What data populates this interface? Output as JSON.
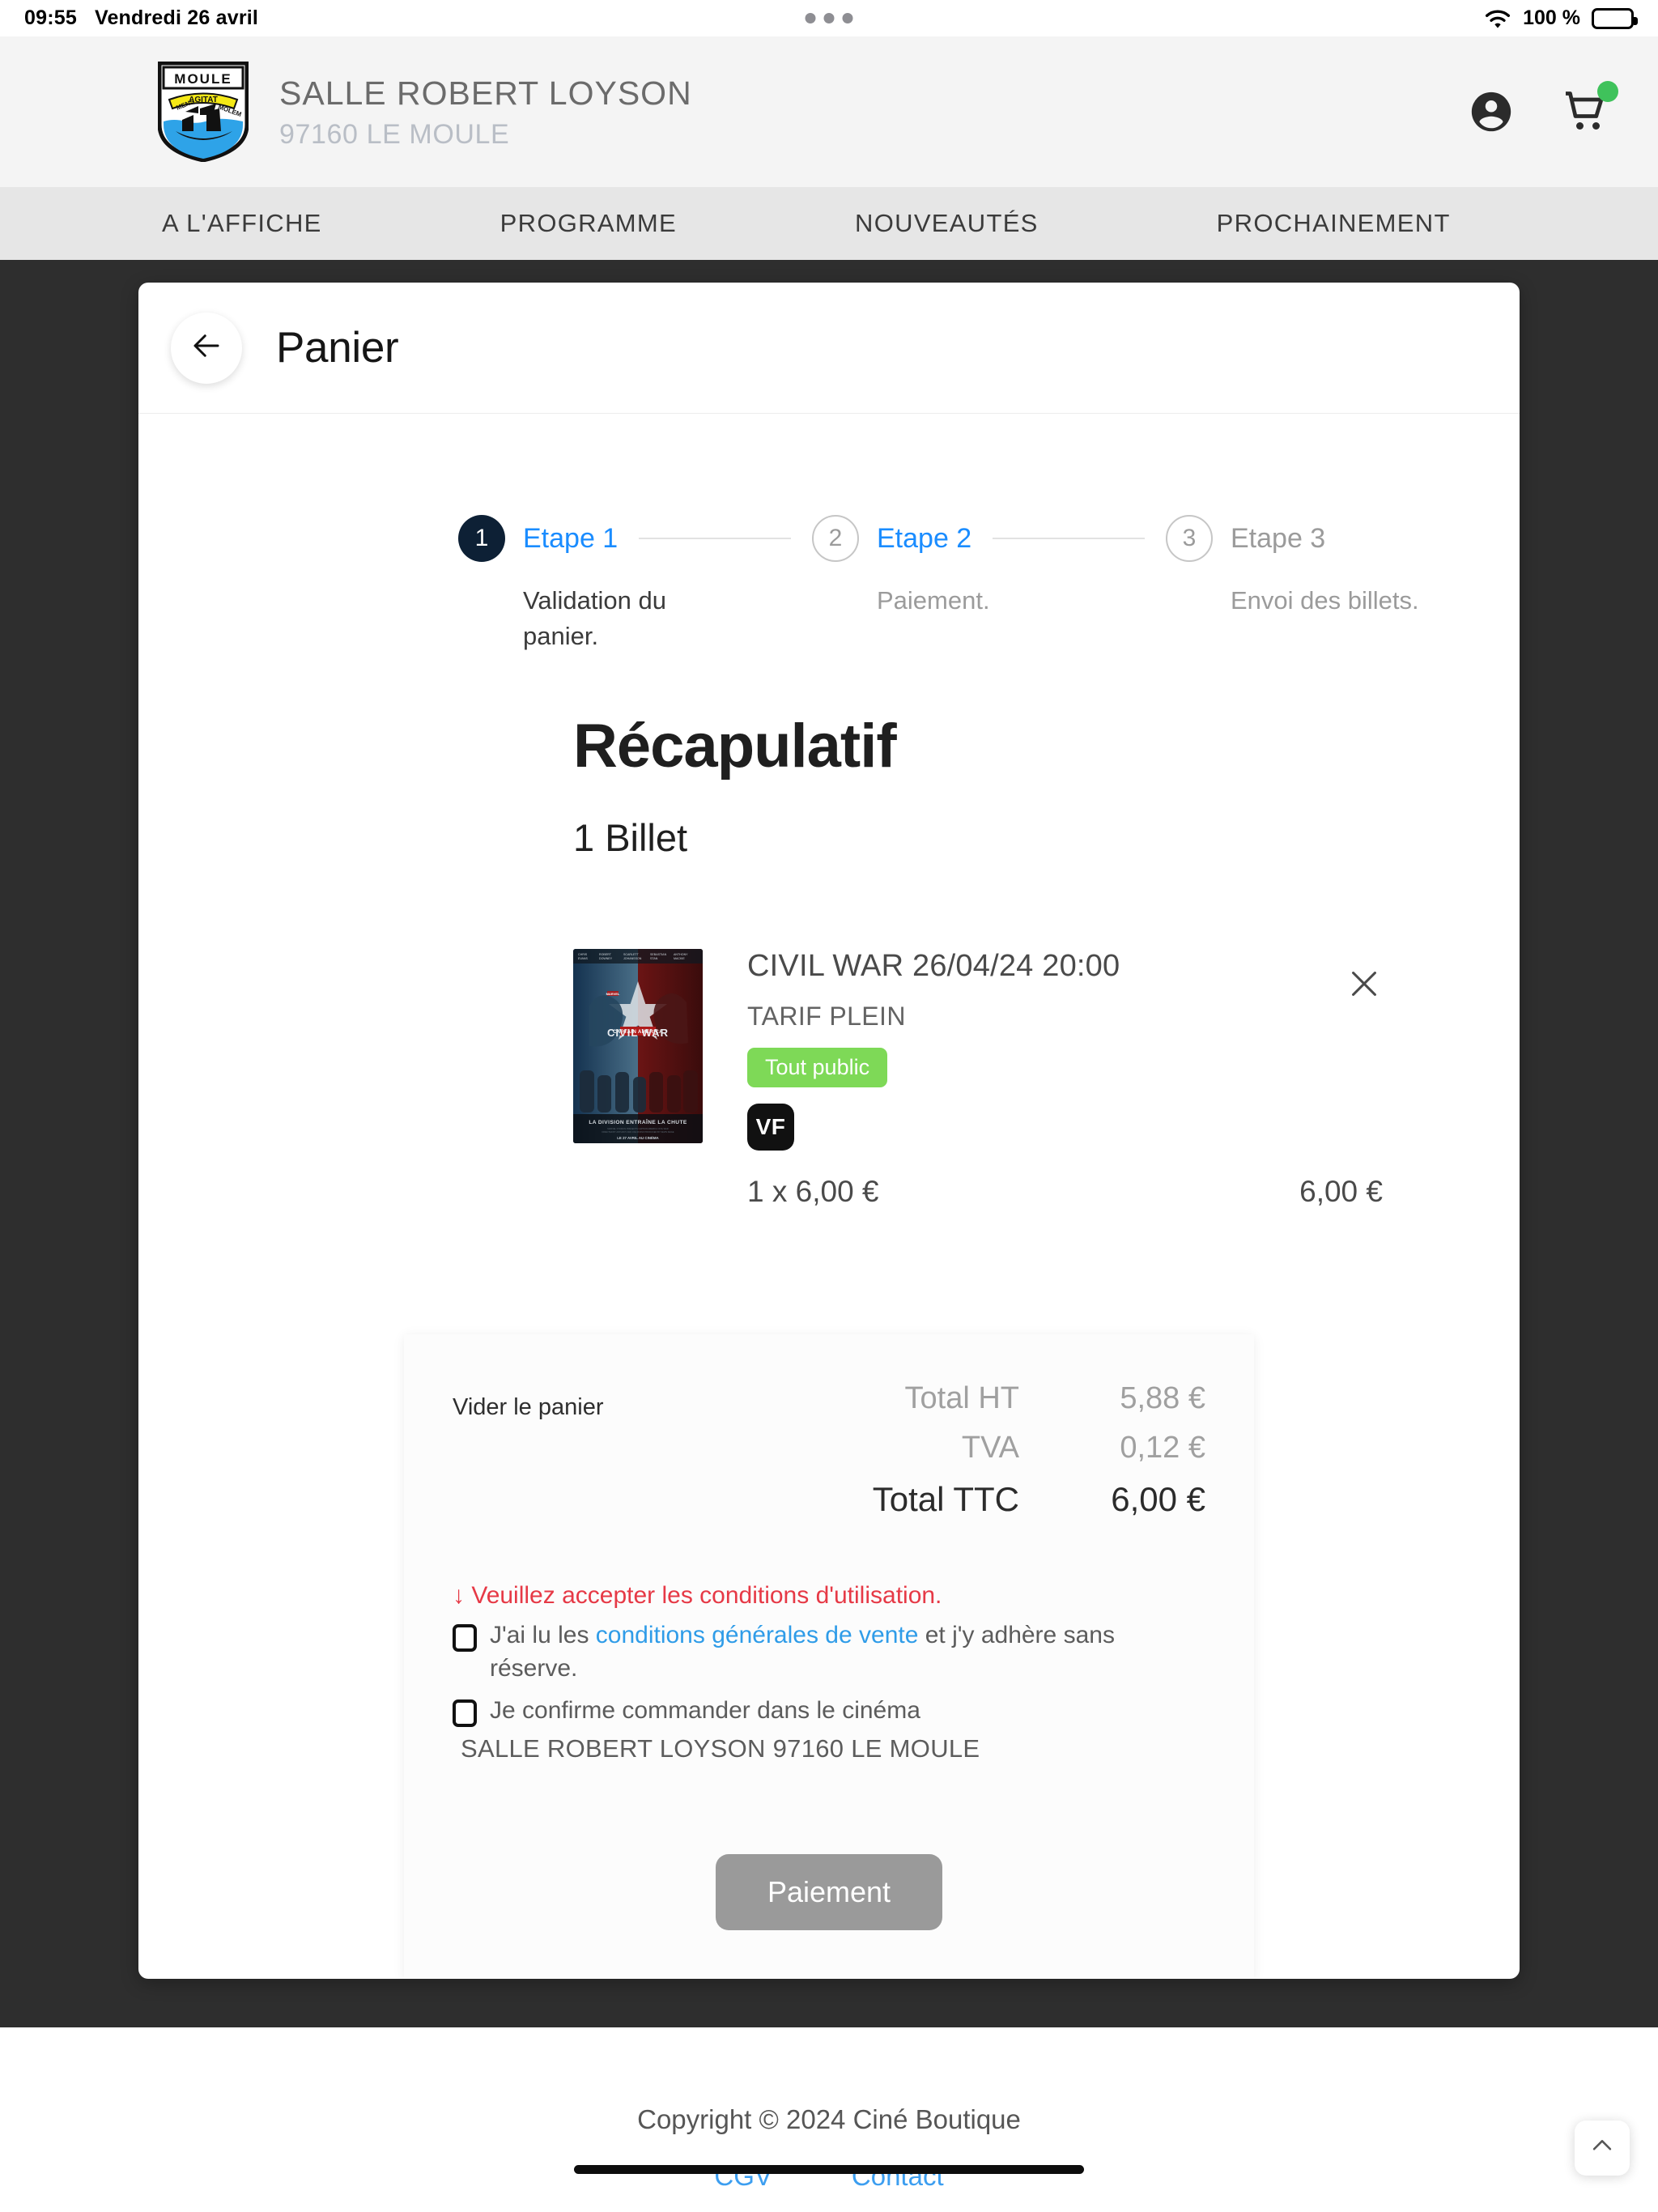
{
  "status_bar": {
    "time": "09:55",
    "date": "Vendredi 26 avril",
    "battery_percent": "100 %",
    "wifi_icon": "wifi-icon",
    "battery_icon": "battery-full-icon",
    "dots_icon": "three-dots-icon"
  },
  "header": {
    "logo_alt": "MOULE",
    "logo_motto": "MENS AGITAT MOLEM",
    "venue_name": "SALLE ROBERT LOYSON",
    "venue_city": "97160 LE MOULE",
    "account_icon": "account-circle-icon",
    "cart_icon": "shopping-cart-icon",
    "cart_badge_color": "#3fc25b"
  },
  "nav": {
    "items": [
      {
        "label": "A L'AFFICHE"
      },
      {
        "label": "PROGRAMME"
      },
      {
        "label": "NOUVEAUTÉS"
      },
      {
        "label": "PROCHAINEMENT"
      }
    ]
  },
  "cart_page": {
    "back_icon": "arrow-left-icon",
    "title": "Panier",
    "stepper": [
      {
        "number": "1",
        "label": "Etape 1",
        "desc": "Validation du panier.",
        "state": "active"
      },
      {
        "number": "2",
        "label": "Etape 2",
        "desc": "Paiement.",
        "state": "idle"
      },
      {
        "number": "3",
        "label": "Etape 3",
        "desc": "Envoi des billets.",
        "state": "idle"
      }
    ],
    "recap_title": "Récapulatif",
    "ticket_count": "1 Billet",
    "tickets": [
      {
        "title": "CIVIL WAR 26/04/24 20:00",
        "tarif": "TARIF PLEIN",
        "audience_badge": "Tout public",
        "version_badge": "VF",
        "quantity_line": "1 x 6,00 €",
        "line_total": "6,00 €",
        "remove_icon": "close-icon",
        "poster_title": "CIVIL WAR",
        "poster_sub": "CAPTAIN AMERICA",
        "poster_tagline": "LA DIVISION ENTRAÎNE LA CHUTE",
        "poster_footer": "LE 27 AVRIL AU CINÉMA"
      }
    ],
    "totals": {
      "clear_cart_label": "Vider le panier",
      "lines": [
        {
          "label": "Total HT",
          "value": "5,88 €",
          "strong": false
        },
        {
          "label": "TVA",
          "value": "0,12 €",
          "strong": false
        },
        {
          "label": "Total TTC",
          "value": "6,00 €",
          "strong": true
        }
      ]
    },
    "conditions": {
      "warning": "↓ Veuillez accepter les conditions d'utilisation.",
      "cgv_prefix": "J'ai lu les ",
      "cgv_link": "conditions générales de vente",
      "cgv_suffix": " et j'y adhère sans réserve.",
      "confirm_text": "Je confirme commander dans le cinéma",
      "cinema_address": "SALLE ROBERT LOYSON 97160 LE MOULE"
    },
    "pay_button": "Paiement"
  },
  "footer": {
    "copyright": "Copyright © 2024 Ciné Boutique",
    "links": [
      {
        "label": "CGV"
      },
      {
        "label": "Contact"
      }
    ],
    "to_top_icon": "chevron-up-icon"
  },
  "colors": {
    "dark_bg": "#2e2e2e",
    "accent_blue": "#1a8cff",
    "step_active": "#0d2035",
    "warn_red": "#e63946",
    "badge_green": "#7ed957",
    "link_blue": "#3c9ef0"
  }
}
